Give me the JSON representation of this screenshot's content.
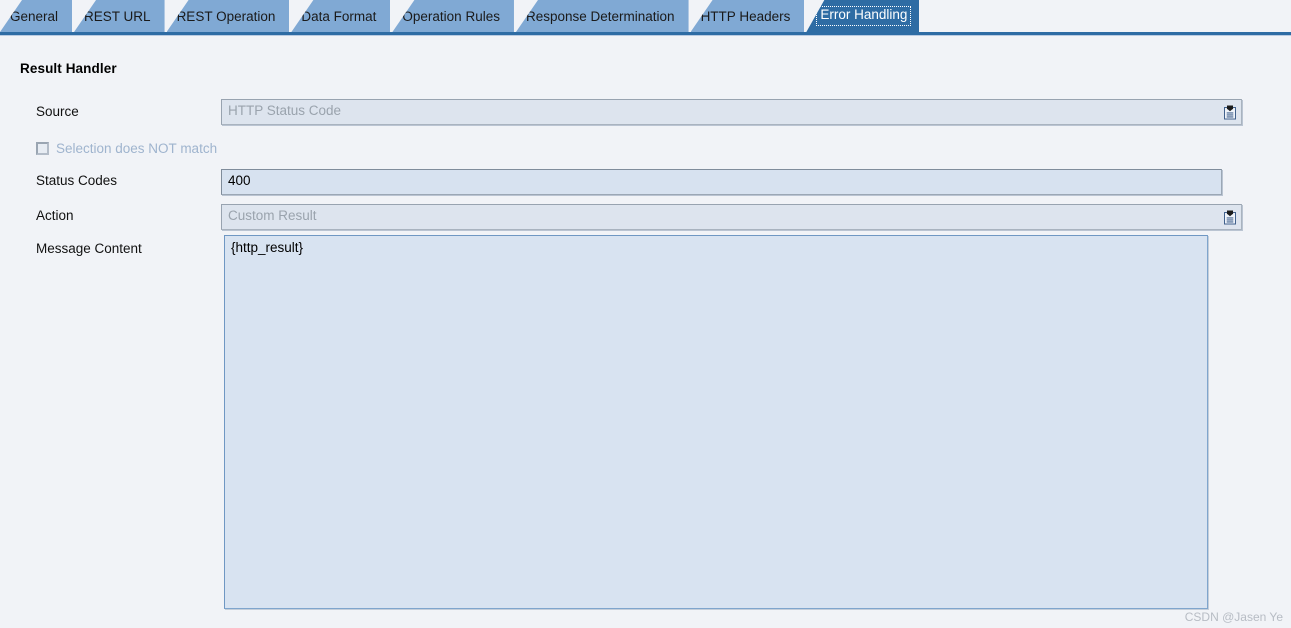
{
  "window": {
    "background_color": "#f1f3f7"
  },
  "tabs": {
    "items": [
      {
        "label": "General",
        "active": false
      },
      {
        "label": "REST URL",
        "active": false
      },
      {
        "label": "REST Operation",
        "active": false
      },
      {
        "label": "Data Format",
        "active": false
      },
      {
        "label": "Operation Rules",
        "active": false
      },
      {
        "label": "Response Determination",
        "active": false
      },
      {
        "label": "HTTP Headers",
        "active": false
      },
      {
        "label": "Error Handling",
        "active": true
      }
    ],
    "active_label": "Error Handling",
    "inactive_color": "#80a9d4",
    "active_color": "#2e6ca4",
    "underline_color": "#2e6ca4"
  },
  "panel": {
    "title": "Result Handler"
  },
  "form": {
    "source": {
      "label": "Source",
      "value": "HTTP Status Code",
      "disabled": true,
      "help_icon": "value-help-icon"
    },
    "negate": {
      "label": "Selection does NOT match",
      "checked": false,
      "disabled": true
    },
    "status_codes": {
      "label": "Status Codes",
      "value": "400",
      "disabled": false
    },
    "action": {
      "label": "Action",
      "value": "Custom Result",
      "disabled": true,
      "help_icon": "value-help-icon"
    },
    "message_content": {
      "label": "Message Content",
      "value": "{http_result}",
      "disabled": false
    }
  },
  "watermark": {
    "text": "CSDN @Jasen Ye"
  }
}
